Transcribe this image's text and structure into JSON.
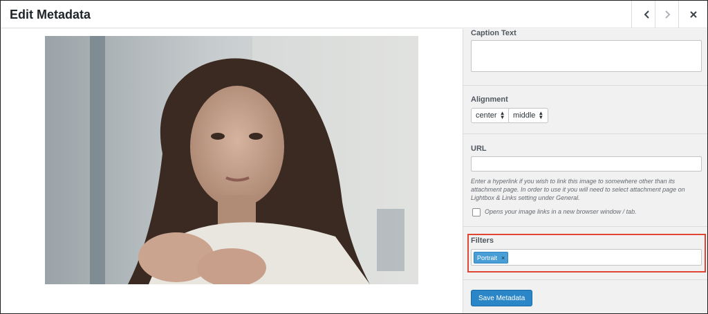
{
  "header": {
    "title": "Edit Metadata",
    "prev_icon": "chevron-left-icon",
    "next_icon": "chevron-right-icon",
    "close_icon": "close-icon"
  },
  "preview": {
    "image_desc": "portrait photo"
  },
  "sidebar": {
    "caption": {
      "label": "Caption Text",
      "value": ""
    },
    "alignment": {
      "label": "Alignment",
      "horizontal": "center",
      "vertical": "middle"
    },
    "url": {
      "label": "URL",
      "value": "",
      "help": "Enter a hyperlink if you wish to link this image to somewhere other than its attachment page. In order to use it you will need to select attachment page on Lightbox & Links setting under General.",
      "new_window_label": "Opens your image links in a new browser window / tab.",
      "new_window_checked": false
    },
    "filters": {
      "label": "Filters",
      "tags": [
        "Portrait"
      ],
      "remove_glyph": "×"
    },
    "save_label": "Save Metadata"
  },
  "colors": {
    "accent": "#2a86c6",
    "tag": "#4a9ed6",
    "highlight": "#e04432"
  }
}
